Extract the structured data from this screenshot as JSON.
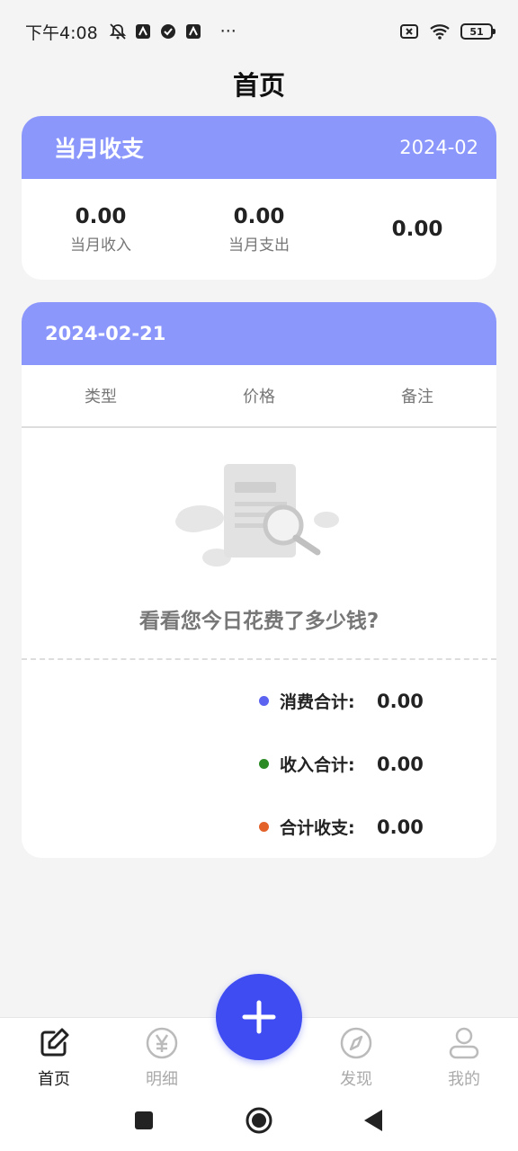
{
  "status_bar": {
    "time": "下午4:08",
    "more": "···",
    "battery": "51"
  },
  "header": {
    "title": "首页"
  },
  "month_card": {
    "title": "当月收支",
    "month": "2024-02",
    "stats": [
      {
        "value": "0.00",
        "label": "当月收入"
      },
      {
        "value": "0.00",
        "label": "当月支出"
      },
      {
        "value": "0.00",
        "label": ""
      }
    ]
  },
  "day_card": {
    "date": "2024-02-21",
    "columns": [
      "类型",
      "价格",
      "备注"
    ],
    "empty_text": "看看您今日花费了多少钱?",
    "summary": [
      {
        "label": "消费合计:",
        "value": "0.00",
        "color": "#5b63f0"
      },
      {
        "label": "收入合计:",
        "value": "0.00",
        "color": "#2c8a25"
      },
      {
        "label": "合计收支:",
        "value": "0.00",
        "color": "#e2622a"
      }
    ]
  },
  "bottom_nav": {
    "items": [
      {
        "label": "首页",
        "icon": "edit-icon"
      },
      {
        "label": "明细",
        "icon": "yen-icon"
      },
      {
        "label": "发现",
        "icon": "compass-icon"
      },
      {
        "label": "我的",
        "icon": "user-icon"
      }
    ],
    "fab_icon": "plus-icon"
  }
}
